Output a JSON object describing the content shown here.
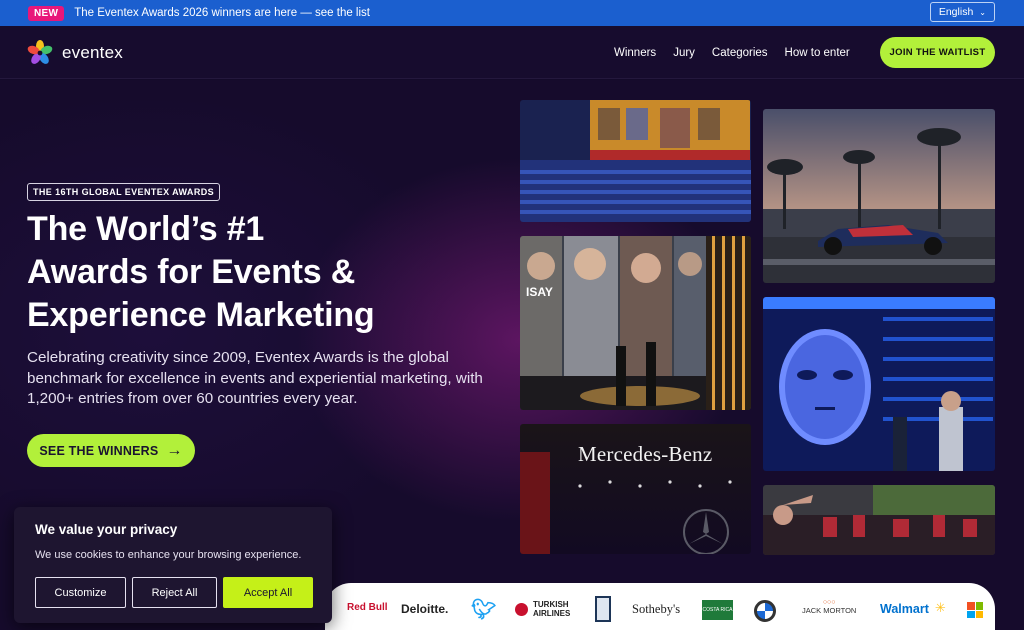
{
  "announcement": {
    "badge": "NEW",
    "text": "The Eventex Awards 2026 winners are here — see the list",
    "language": "English"
  },
  "nav": {
    "brand": "eventex",
    "links": [
      "Winners",
      "Jury",
      "Categories",
      "How to enter"
    ],
    "waitlist_label": "JOIN THE WAITLIST"
  },
  "hero": {
    "eyebrow": "THE 16TH GLOBAL EVENTEX AWARDS",
    "headline": [
      "The World’s #1",
      "Awards for Events &",
      "Experience Marketing"
    ],
    "subcopy": "Celebrating creativity since 2009, Eventex Awards is the global benchmark for excellence in events and experiential marketing, with 1,200+ entries from over 60 countries every year.",
    "cta_label": "SEE THE WINNERS"
  },
  "gallery": {
    "tiles": [
      {
        "name": "conference-hall-photo"
      },
      {
        "name": "race-car-photo"
      },
      {
        "name": "chef-show-stage-photo"
      },
      {
        "name": "robot-face-exhibit-photo"
      },
      {
        "name": "mercedes-benz-stage-photo",
        "caption": "Mercedes-Benz"
      },
      {
        "name": "street-crowd-photo"
      }
    ]
  },
  "clients": {
    "logos": [
      "Red Bull",
      "Deloitte.",
      "Twitter",
      "TURKISH AIRLINES",
      "Rolls-Royce",
      "Sotheby's",
      "COSTA RICA",
      "BMW",
      "JACK MORTON",
      "Walmart",
      "Microsoft"
    ]
  },
  "cookie": {
    "title": "We value your privacy",
    "text": "We use cookies to enhance your browsing experience.",
    "customize": "Customize",
    "reject": "Reject All",
    "accept": "Accept All"
  },
  "colors": {
    "accent": "#b2f03a",
    "topbar": "#1b5fcf",
    "badge": "#e8177a",
    "background": "#160b2c"
  }
}
